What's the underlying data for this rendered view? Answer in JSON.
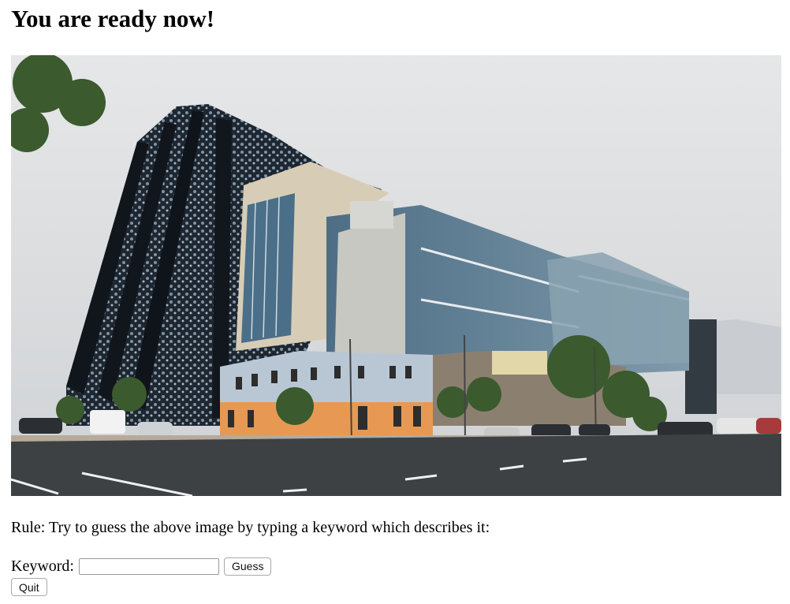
{
  "header": {
    "title": "You are ready now!"
  },
  "game": {
    "rule_text": "Rule: Try to guess the above image by typing a keyword which describes it:",
    "keyword_label": "Keyword:",
    "keyword_value": "",
    "guess_label": "Guess",
    "quit_label": "Quit"
  },
  "colors": {
    "sky": "#d8dadc",
    "dark_facade": "#1e2630",
    "beige_facade": "#d7cdb6",
    "glass": "#5f7f93",
    "old_building": "#b9c7d5",
    "orange_wall": "#e79954",
    "road": "#3e4143",
    "tree": "#3b5a2e"
  }
}
